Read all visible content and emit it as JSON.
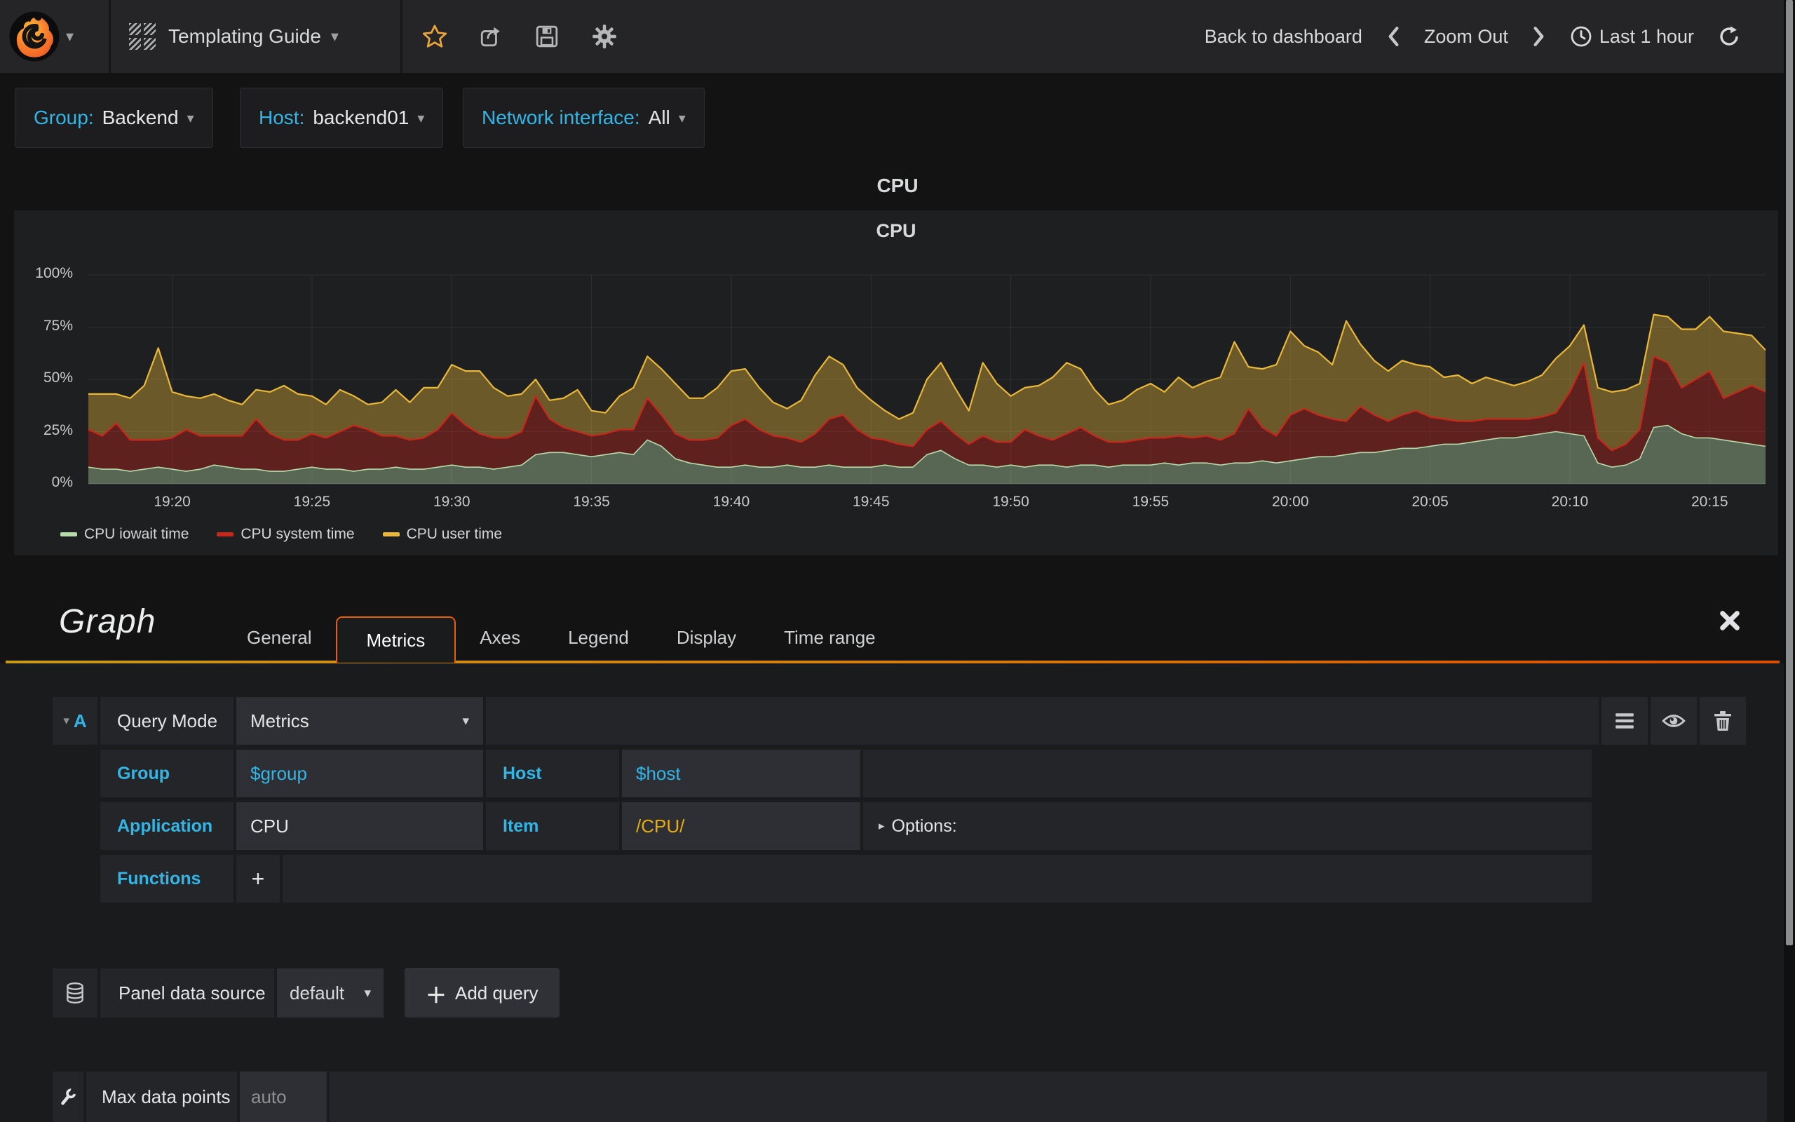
{
  "navbar": {
    "title": "Templating Guide",
    "back_to_dashboard": "Back to dashboard",
    "zoom_out": "Zoom Out",
    "time_range": "Last 1 hour"
  },
  "submenu": {
    "variables": [
      {
        "label": "Group:",
        "value": "Backend"
      },
      {
        "label": "Host:",
        "value": "backend01"
      },
      {
        "label": "Network interface:",
        "value": "All"
      }
    ]
  },
  "panel": {
    "header_title": "CPU",
    "title": "CPU"
  },
  "editor": {
    "title": "Graph",
    "tabs": [
      "General",
      "Metrics",
      "Axes",
      "Legend",
      "Display",
      "Time range"
    ],
    "active_tab": "Metrics"
  },
  "query": {
    "row_letter": "A",
    "query_mode_label": "Query Mode",
    "query_mode_value": "Metrics",
    "group_label": "Group",
    "group_value": "$group",
    "host_label": "Host",
    "host_value": "$host",
    "application_label": "Application",
    "application_value": "CPU",
    "item_label": "Item",
    "item_value": "/CPU/",
    "options_label": "Options:",
    "functions_label": "Functions",
    "add_function_label": "+"
  },
  "datasource": {
    "label": "Panel data source",
    "value": "default",
    "add_query_label": "Add query"
  },
  "settings": {
    "max_data_points_label": "Max data points",
    "max_data_points_placeholder": "auto"
  },
  "chart_data": {
    "type": "area",
    "stacked": true,
    "title": "CPU",
    "xlabel": "",
    "ylabel": "percent",
    "ylim": [
      0,
      100
    ],
    "grid": true,
    "legend_position": "bottom-left",
    "x_start": "19:17",
    "x_end": "20:17",
    "x_minutes_span": 60,
    "sample_interval_seconds": 30,
    "x_ticks": {
      "labels": [
        "19:20",
        "19:25",
        "19:30",
        "19:35",
        "19:40",
        "19:45",
        "19:50",
        "19:55",
        "20:00",
        "20:05",
        "20:10",
        "20:15"
      ],
      "minutes": [
        3,
        8,
        13,
        18,
        23,
        28,
        33,
        38,
        43,
        48,
        53,
        58
      ]
    },
    "y_ticks": {
      "labels": [
        "100%",
        "75%",
        "50%",
        "25%",
        "0%"
      ],
      "values": [
        100,
        75,
        50,
        25,
        0
      ]
    },
    "series": [
      {
        "name": "CPU iowait time",
        "color": "#b7dbab",
        "values": [
          8,
          7,
          7,
          6,
          7,
          8,
          7,
          6,
          7,
          9,
          8,
          7,
          7,
          6,
          6,
          7,
          8,
          7,
          7,
          6,
          7,
          7,
          8,
          7,
          7,
          8,
          9,
          8,
          8,
          7,
          8,
          9,
          14,
          15,
          15,
          14,
          13,
          14,
          15,
          14,
          21,
          18,
          12,
          10,
          9,
          8,
          8,
          9,
          8,
          8,
          9,
          8,
          8,
          9,
          8,
          8,
          8,
          9,
          8,
          8,
          14,
          16,
          12,
          9,
          9,
          8,
          9,
          8,
          9,
          9,
          8,
          9,
          9,
          8,
          9,
          9,
          9,
          10,
          9,
          10,
          10,
          9,
          10,
          10,
          11,
          10,
          11,
          12,
          13,
          13,
          14,
          15,
          15,
          16,
          17,
          17,
          18,
          19,
          19,
          20,
          21,
          22,
          22,
          23,
          24,
          25,
          24,
          23,
          10,
          8,
          9,
          12,
          27,
          28,
          24,
          22,
          22,
          21,
          20,
          19,
          18
        ]
      },
      {
        "name": "CPU system time",
        "color": "#c9261c",
        "values": [
          18,
          16,
          22,
          15,
          14,
          13,
          15,
          20,
          16,
          14,
          15,
          16,
          24,
          18,
          15,
          14,
          16,
          15,
          18,
          22,
          19,
          16,
          15,
          14,
          15,
          18,
          25,
          20,
          16,
          15,
          14,
          16,
          28,
          16,
          12,
          11,
          10,
          10,
          11,
          12,
          20,
          15,
          12,
          11,
          12,
          14,
          20,
          22,
          18,
          15,
          13,
          12,
          16,
          22,
          25,
          18,
          14,
          12,
          11,
          10,
          12,
          14,
          12,
          10,
          14,
          12,
          11,
          18,
          14,
          12,
          16,
          18,
          14,
          12,
          11,
          12,
          13,
          12,
          14,
          12,
          13,
          12,
          14,
          26,
          16,
          13,
          22,
          24,
          20,
          18,
          16,
          22,
          18,
          14,
          16,
          18,
          14,
          12,
          11,
          10,
          10,
          9,
          9,
          8,
          8,
          9,
          20,
          35,
          12,
          8,
          10,
          14,
          34,
          30,
          22,
          28,
          32,
          20,
          24,
          28,
          26
        ]
      },
      {
        "name": "CPU user time",
        "color": "#eab839",
        "values": [
          17,
          20,
          14,
          20,
          26,
          44,
          22,
          16,
          18,
          20,
          17,
          15,
          14,
          20,
          26,
          22,
          18,
          16,
          20,
          14,
          12,
          16,
          22,
          18,
          24,
          20,
          23,
          26,
          30,
          24,
          20,
          18,
          8,
          9,
          14,
          20,
          12,
          10,
          16,
          20,
          20,
          22,
          24,
          20,
          20,
          24,
          26,
          24,
          20,
          16,
          14,
          20,
          28,
          30,
          24,
          20,
          18,
          14,
          12,
          16,
          24,
          28,
          22,
          16,
          35,
          28,
          22,
          20,
          24,
          30,
          34,
          28,
          22,
          18,
          20,
          24,
          26,
          22,
          28,
          24,
          26,
          30,
          44,
          20,
          28,
          34,
          40,
          30,
          30,
          26,
          48,
          30,
          26,
          24,
          26,
          22,
          24,
          20,
          22,
          18,
          20,
          18,
          16,
          18,
          20,
          26,
          22,
          18,
          24,
          28,
          26,
          22,
          20,
          22,
          28,
          24,
          26,
          32,
          28,
          24,
          20
        ]
      }
    ]
  }
}
